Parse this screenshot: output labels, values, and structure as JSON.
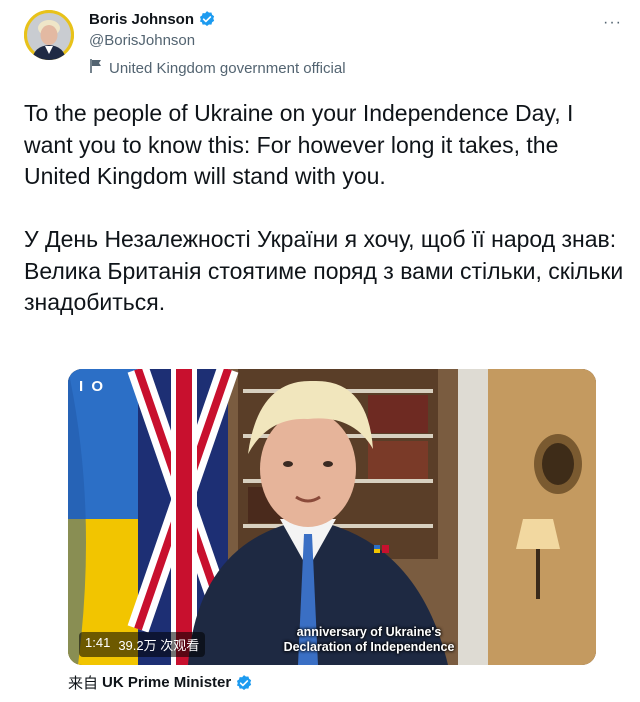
{
  "author": {
    "name": "Boris Johnson",
    "handle": "@BorisJohnson",
    "label": "United Kingdom government official",
    "avatar_icon": "avatar-photo",
    "verified_icon": "verified-badge-icon",
    "label_icon": "flag-icon"
  },
  "tweet": {
    "text": "To the people of Ukraine on your Independence Day, I want you to know this: For however long it takes, the United Kingdom will stand with you.\n\nУ День Незалежності України я хочу, щоб її народ знав:\nВелика Британія стоятиме поряд з вами стільки, скільки знадобиться."
  },
  "video": {
    "channel_logo": "I O",
    "duration": "1:41",
    "views": "39.2万 次观看",
    "caption_line1": "anniversary of Ukraine's",
    "caption_line2": "Declaration of Independence"
  },
  "source": {
    "prefix": "来自",
    "name": "UK Prime Minister",
    "verified_icon": "verified-badge-icon"
  },
  "menu": {
    "more_label": "···"
  },
  "colors": {
    "accent": "#1d9bf0",
    "text": "#0f1419",
    "secondary": "#536471",
    "avatar_ring": "#e8c21a"
  }
}
